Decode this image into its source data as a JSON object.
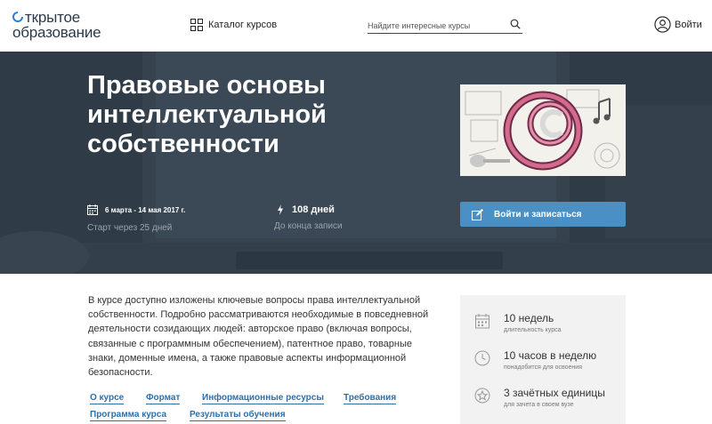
{
  "header": {
    "logo_line1": "ткрытое",
    "logo_line2": "образование",
    "catalog_label": "Каталог курсов",
    "search_placeholder": "Найдите интересные курсы",
    "login_label": "Войти"
  },
  "hero": {
    "title": "Правовые основы интеллектуальной собственности",
    "dates": "6 марта - 14 мая 2017 г.",
    "start_note": "Старт через 25 дней",
    "days_left": "108 дней",
    "days_note": "До конца записи",
    "enroll_label": "Войти и записаться"
  },
  "course": {
    "description": "В курсе доступно изложены ключевые вопросы права интеллектуальной собственности. Подробно рассматриваются необходимые в повседневной деятельности созидающих людей: авторское право (включая вопросы, связанные с программным обеспечением), патентное право, товарные знаки, доменные имена, а также правовые аспекты информационной безопасности.",
    "links": [
      "О курсе",
      "Формат",
      "Информационные ресурсы",
      "Требования",
      "Программа курса",
      "Результаты обучения"
    ]
  },
  "info": [
    {
      "main": "10 недель",
      "sub": "длительность курса",
      "icon": "calendar-icon"
    },
    {
      "main": "10 часов в неделю",
      "sub": "понадобится для освоения",
      "icon": "clock-icon"
    },
    {
      "main": "3 зачётных единицы",
      "sub": "для зачета в своем вузе",
      "icon": "star-icon"
    }
  ],
  "colors": {
    "hero_bg": "#2f3c48",
    "accent_button": "#4a90c4",
    "link": "#2f6fa8",
    "logo_ring": "#2a7fd4"
  }
}
